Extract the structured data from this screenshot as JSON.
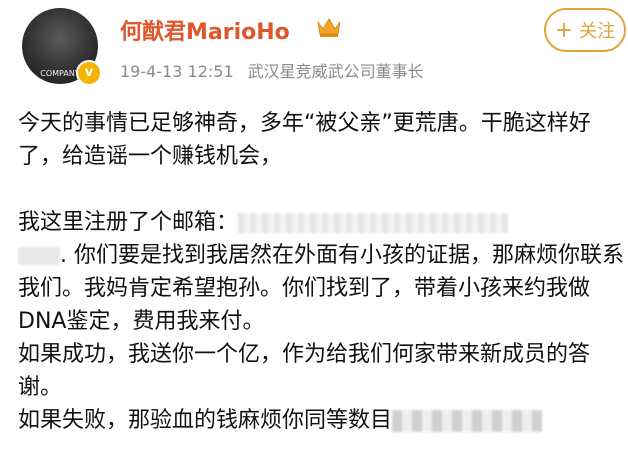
{
  "post": {
    "author_name": "何猷君MarioHo",
    "avatar_caption": "COMPANY",
    "verified_badge": "v",
    "date": "19-4-13 12:51",
    "verification": "武汉星竞威武公司董事长",
    "follow_plus": "+",
    "follow_label": "关注",
    "p1": "今天的事情已足够神奇，多年“被父亲”更荒唐。干脆这样好了，给造谣一个赚钱机会，",
    "p2a": "我这里注册了个邮箱：",
    "p2b": ". 你们要是找到我居然在外面有小孩的证据，那麻烦你联系我们。我妈肯定希望抱孙。你们找到了，带着小孩来约我做DNA鉴定，费用我来付。",
    "p3": "如果成功，我送你一个亿，作为给我们何家带来新成员的答谢。",
    "p4": "如果失败，那验血的钱麻烦你同等数目"
  },
  "icons": {
    "crown": "crown-icon",
    "verified": "verified-v-icon"
  },
  "colors": {
    "name": "#e0562b",
    "follow": "#e0a33b",
    "meta": "#8a8a8a"
  }
}
